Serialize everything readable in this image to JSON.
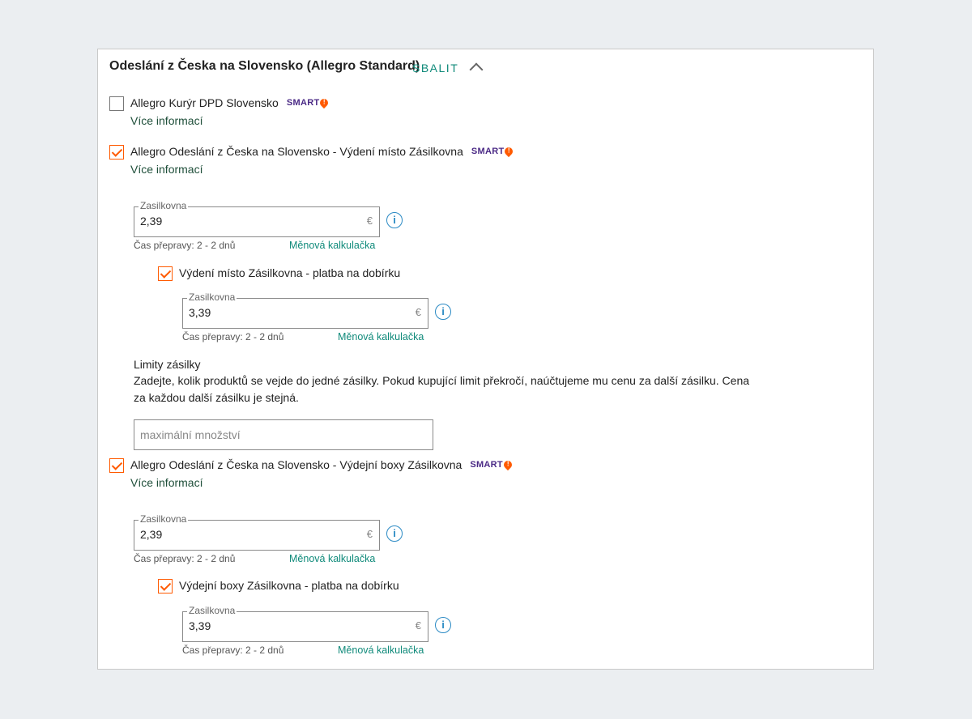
{
  "section": {
    "title": "Odeslání z Česka na Slovensko (Allegro Standard)",
    "collapse_label": "SBALIT"
  },
  "options": [
    {
      "label": "Allegro Kurýr DPD Slovensko",
      "badge": "SMART",
      "checked": false,
      "more_info": "Více informací"
    },
    {
      "label": "Allegro Odeslání z Česka na Slovensko - Výdení místo Zásilkovna",
      "badge": "SMART",
      "checked": true,
      "more_info": "Více informací",
      "price": {
        "legend": "Zasilkovna",
        "value": "2,39",
        "unit": "€",
        "transit": "Čas přepravy: 2 - 2 dnů",
        "calculator": "Měnová kalkulačka"
      },
      "cod": {
        "label": "Výdení místo Zásilkovna - platba na dobírku",
        "checked": true,
        "price": {
          "legend": "Zasilkovna",
          "value": "3,39",
          "unit": "€",
          "transit": "Čas přepravy: 2 - 2 dnů",
          "calculator": "Měnová kalkulačka"
        }
      }
    },
    {
      "label": "Allegro Odeslání z Česka na Slovensko - Výdejní boxy Zásilkovna",
      "badge": "SMART",
      "checked": true,
      "more_info": "Více informací",
      "price": {
        "legend": "Zasilkovna",
        "value": "2,39",
        "unit": "€",
        "transit": "Čas přepravy: 2 - 2 dnů",
        "calculator": "Měnová kalkulačka"
      },
      "cod": {
        "label": "Výdejní boxy Zásilkovna - platba na dobírku",
        "checked": true,
        "price": {
          "legend": "Zasilkovna",
          "value": "3,39",
          "unit": "€",
          "transit": "Čas přepravy: 2 - 2 dnů",
          "calculator": "Měnová kalkulačka"
        }
      }
    }
  ],
  "limits": {
    "title": "Limity zásilky",
    "description_line1": "Zadejte, kolik produktů se vejde do jedné zásilky. Pokud kupující limit překročí, naúčtujeme mu cenu za další zásilku. Cena",
    "description_line2": "za každou další zásilku je stejná.",
    "placeholder": "maximální množství"
  },
  "colors": {
    "accent": "#ff5a00",
    "teal": "#0f8a7a",
    "smart": "#4b2a86",
    "info": "#2a8ac4"
  }
}
